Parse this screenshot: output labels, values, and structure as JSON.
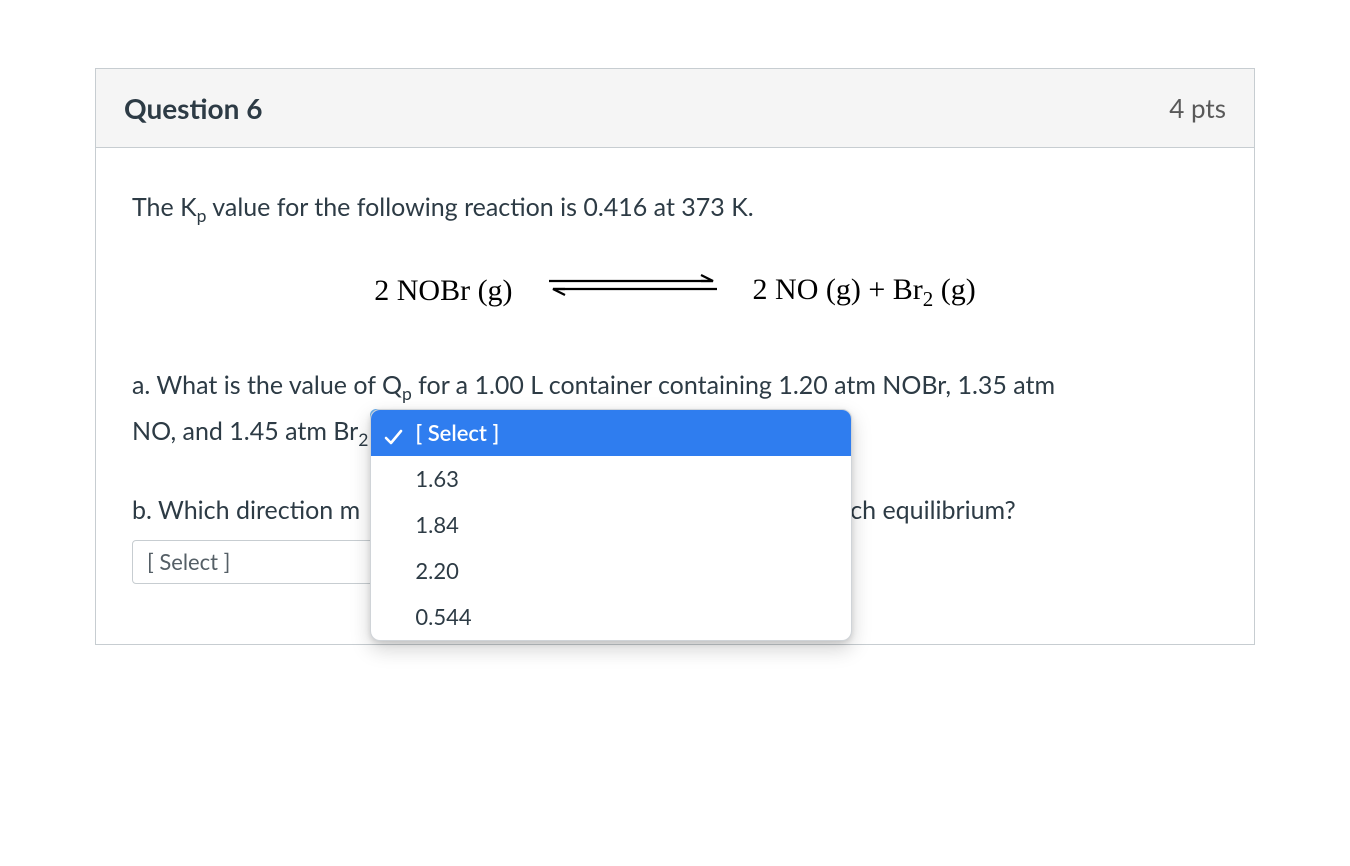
{
  "question": {
    "title": "Question 6",
    "points": "4 pts",
    "intro_prefix": "The K",
    "intro_sub": "p",
    "intro_suffix": " value for the following reaction is 0.416 at 373 K.",
    "equation": {
      "left_pre": "2 NOBr (g)",
      "right_pre": "2 NO (g)  + Br",
      "right_sub": "2",
      "right_post": " (g)"
    },
    "part_a": {
      "line1_prefix": "a.  What is the value of Q",
      "line1_sub": "p",
      "line1_suffix": " for a 1.00 L container containing 1.20 atm NOBr, 1.35 atm",
      "line2_prefix": "NO, and 1.45 atm Br",
      "line2_sub": "2"
    },
    "dropdown_a": {
      "placeholder": "[ Select ]",
      "selected_label": "[ Select ]",
      "options": [
        "[ Select ]",
        "1.63",
        "1.84",
        "2.20",
        "0.544"
      ]
    },
    "part_b": {
      "text_left": "b.  Which direction m",
      "text_right": "ch equilibrium?"
    },
    "dropdown_b": {
      "placeholder": "[ Select ]"
    }
  }
}
